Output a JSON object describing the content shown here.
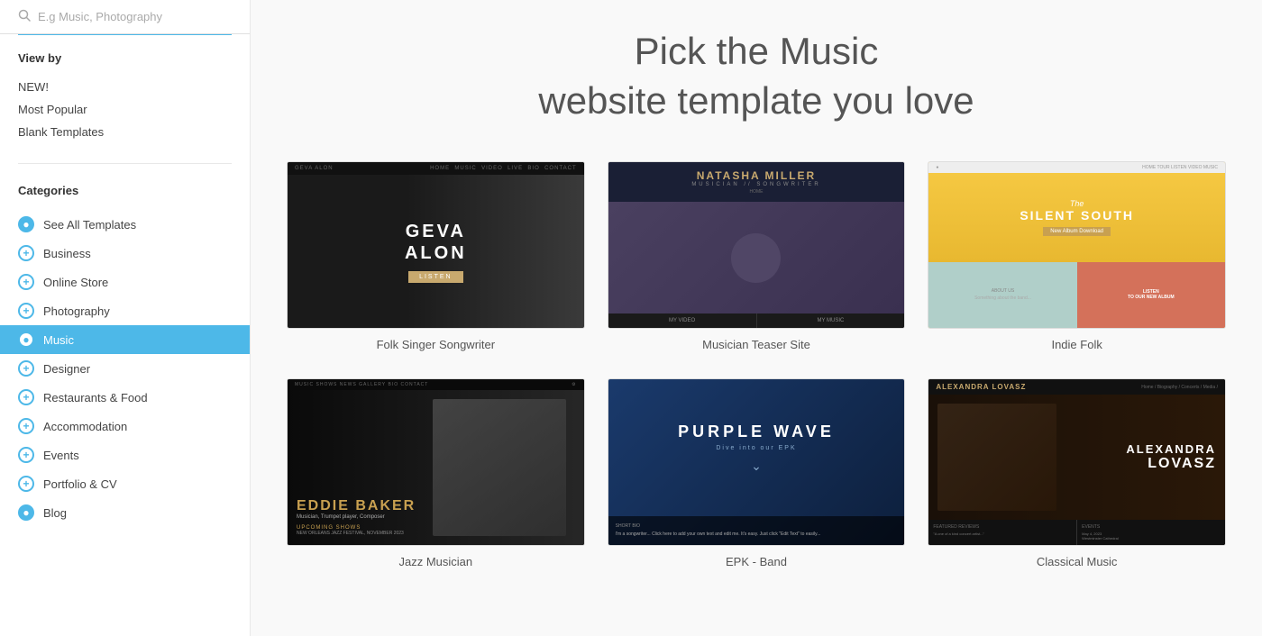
{
  "search": {
    "placeholder": "E.g Music, Photography"
  },
  "sidebar": {
    "view_by_title": "View by",
    "view_by_items": [
      {
        "id": "new",
        "label": "NEW!"
      },
      {
        "id": "most-popular",
        "label": "Most Popular"
      },
      {
        "id": "blank-templates",
        "label": "Blank Templates"
      }
    ],
    "categories_title": "Categories",
    "categories": [
      {
        "id": "see-all",
        "label": "See All Templates",
        "icon": "filled",
        "active": false
      },
      {
        "id": "business",
        "label": "Business",
        "icon": "plus",
        "active": false
      },
      {
        "id": "online-store",
        "label": "Online Store",
        "icon": "plus",
        "active": false
      },
      {
        "id": "photography",
        "label": "Photography",
        "icon": "plus",
        "active": false
      },
      {
        "id": "music",
        "label": "Music",
        "icon": "filled",
        "active": true
      },
      {
        "id": "designer",
        "label": "Designer",
        "icon": "plus",
        "active": false
      },
      {
        "id": "restaurants",
        "label": "Restaurants & Food",
        "icon": "plus",
        "active": false
      },
      {
        "id": "accommodation",
        "label": "Accommodation",
        "icon": "plus",
        "active": false
      },
      {
        "id": "events",
        "label": "Events",
        "icon": "plus",
        "active": false
      },
      {
        "id": "portfolio",
        "label": "Portfolio & CV",
        "icon": "plus",
        "active": false
      },
      {
        "id": "blog",
        "label": "Blog",
        "icon": "filled",
        "active": false
      }
    ]
  },
  "main": {
    "title_line1": "Pick the Music",
    "title_line2": "website template you love",
    "templates": [
      {
        "id": "folk-singer",
        "label": "Folk Singer Songwriter",
        "name": "GEVA\nALON"
      },
      {
        "id": "musician-teaser",
        "label": "Musician Teaser Site",
        "name": "NATASHA MILLER"
      },
      {
        "id": "indie-folk",
        "label": "Indie Folk",
        "name": "The Silent South"
      },
      {
        "id": "jazz-musician",
        "label": "Jazz Musician",
        "name": "EDDIE BAKER"
      },
      {
        "id": "epk-band",
        "label": "EPK - Band",
        "name": "PURPLE WAVE"
      },
      {
        "id": "classical-music",
        "label": "Classical Music",
        "name": "ALEXANDRA LOVASZ"
      }
    ]
  }
}
